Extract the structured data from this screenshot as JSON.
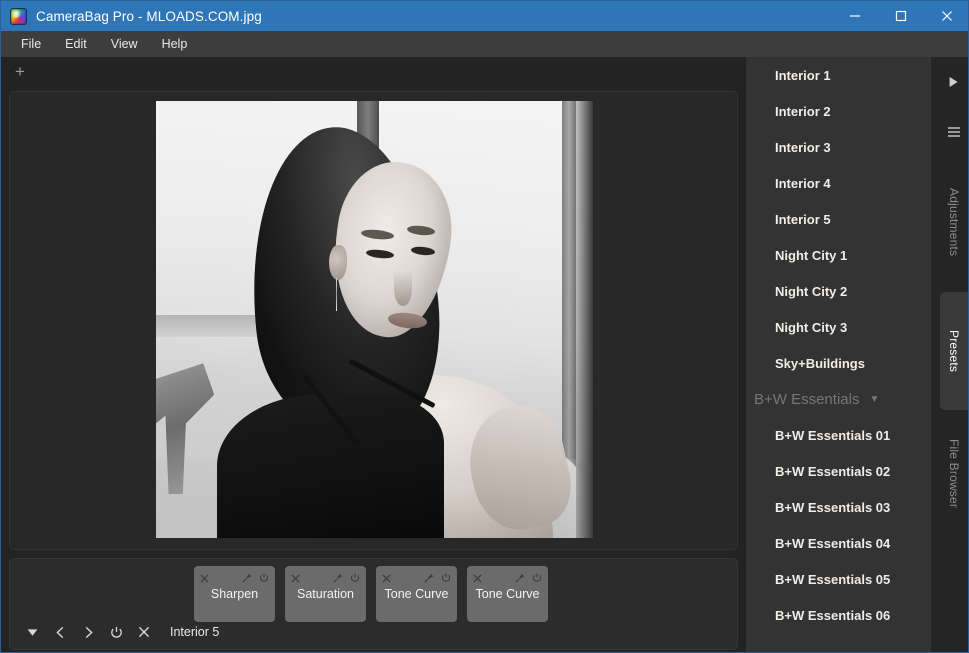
{
  "window": {
    "title": "CameraBag Pro - MLOADS.COM.jpg",
    "app_icon": "camerabag-prism-icon",
    "accent_color": "#2e76b8",
    "controls": {
      "minimize": "minimize-icon",
      "maximize": "maximize-icon",
      "close": "close-icon"
    }
  },
  "menubar": {
    "items": [
      {
        "label": "File"
      },
      {
        "label": "Edit"
      },
      {
        "label": "View"
      },
      {
        "label": "Help"
      }
    ]
  },
  "tabstrip": {
    "add_tab_label": "+"
  },
  "canvas": {
    "image_name": "MLOADS.COM.jpg",
    "description": "black-and-white portrait photograph of a woman looking over her shoulder"
  },
  "bottom_panel": {
    "tiles": [
      {
        "label": "Sharpen",
        "close_icon": "close-icon",
        "pin_icon": "pin-icon",
        "power_icon": "power-icon"
      },
      {
        "label": "Saturation",
        "close_icon": "close-icon",
        "pin_icon": "pin-icon",
        "power_icon": "power-icon"
      },
      {
        "label": "Tone Curve",
        "close_icon": "close-icon",
        "pin_icon": "pin-icon",
        "power_icon": "power-icon"
      },
      {
        "label": "Tone Curve",
        "close_icon": "close-icon",
        "pin_icon": "pin-icon",
        "power_icon": "power-icon"
      }
    ],
    "controls": [
      {
        "name": "dropdown-toggle",
        "icon": "caret-down-icon",
        "glyph": "▼"
      },
      {
        "name": "previous-preset",
        "icon": "chevron-left-icon",
        "glyph": "‹"
      },
      {
        "name": "next-preset",
        "icon": "chevron-right-icon",
        "glyph": "›"
      },
      {
        "name": "power-toggle",
        "icon": "power-icon",
        "glyph": "⏻"
      },
      {
        "name": "clear-preset",
        "icon": "close-icon",
        "glyph": "×"
      }
    ],
    "active_preset_label": "Interior 5"
  },
  "sidebar": {
    "presets": [
      {
        "label": "Interior 1",
        "type": "preset"
      },
      {
        "label": "Interior 2",
        "type": "preset"
      },
      {
        "label": "Interior 3",
        "type": "preset"
      },
      {
        "label": "Interior 4",
        "type": "preset"
      },
      {
        "label": "Interior 5",
        "type": "preset"
      },
      {
        "label": "Night City 1",
        "type": "preset"
      },
      {
        "label": "Night City 2",
        "type": "preset"
      },
      {
        "label": "Night City 3",
        "type": "preset"
      },
      {
        "label": "Sky+Buildings",
        "type": "preset"
      },
      {
        "label": "B+W Essentials",
        "type": "group",
        "caret": "▼"
      },
      {
        "label": "B+W Essentials 01",
        "type": "preset"
      },
      {
        "label": "B+W Essentials 02",
        "type": "preset"
      },
      {
        "label": "B+W Essentials 03",
        "type": "preset"
      },
      {
        "label": "B+W Essentials 04",
        "type": "preset"
      },
      {
        "label": "B+W Essentials 05",
        "type": "preset"
      },
      {
        "label": "B+W Essentials 06",
        "type": "preset"
      }
    ]
  },
  "rail": {
    "expand_icon": "play-arrow-icon",
    "menu_icon": "hamburger-icon",
    "tabs": [
      {
        "label": "Adjustments",
        "active": false
      },
      {
        "label": "Presets",
        "active": true
      },
      {
        "label": "File Browser",
        "active": false
      }
    ]
  }
}
